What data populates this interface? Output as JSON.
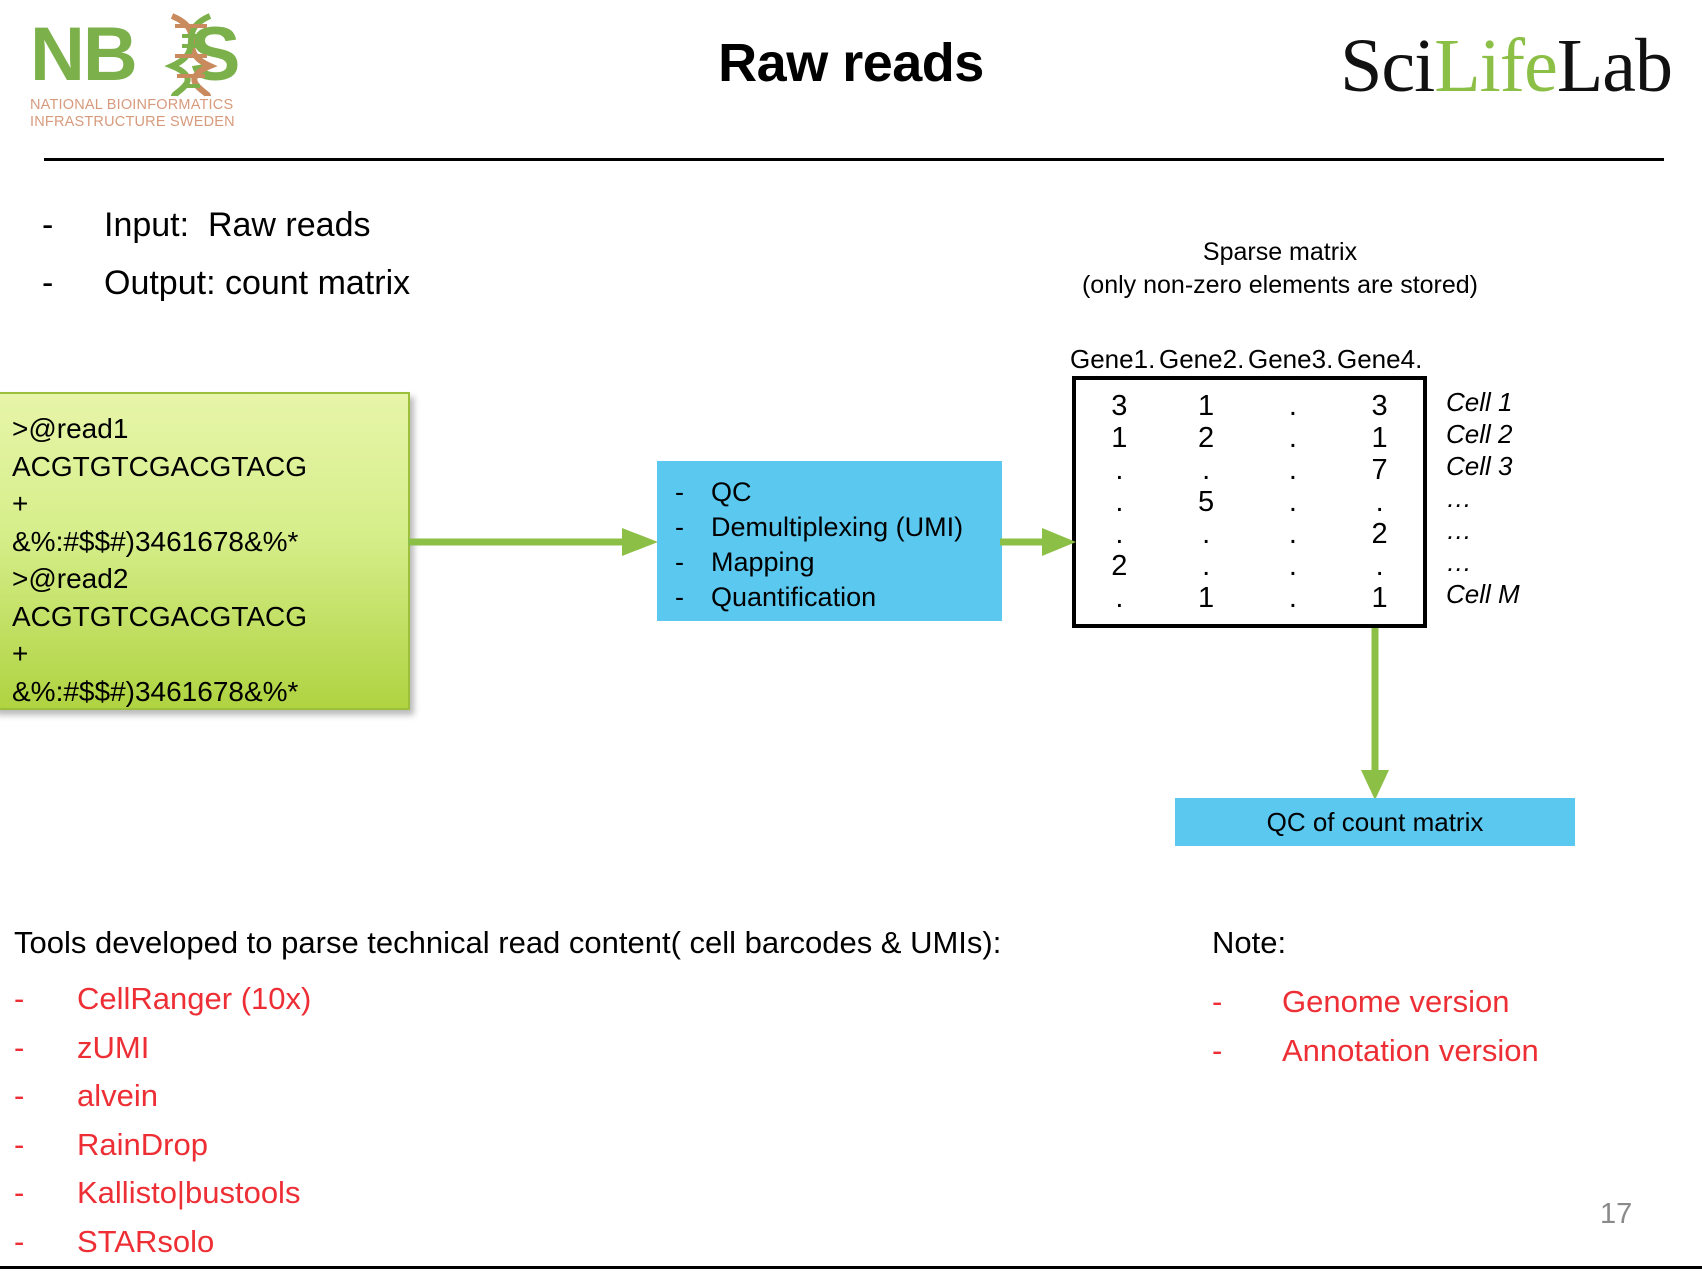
{
  "header": {
    "title": "Raw reads",
    "nbis_logo": {
      "wordmark_left": "NB",
      "wordmark_right": "S",
      "subtitle_line1": "NATIONAL BIOINFORMATICS",
      "subtitle_line2": "INFRASTRUCTURE SWEDEN",
      "green": "#7BB04A",
      "subtitle_color": "#D79A7C"
    },
    "scilifelab_logo": {
      "part1": "Sci",
      "part2": "Life",
      "part3": "Lab",
      "green": "#8CBF45"
    }
  },
  "io": {
    "dash": "-",
    "rows": [
      {
        "label": "Input:  Raw reads"
      },
      {
        "label": "Output: count matrix"
      }
    ]
  },
  "fastq": {
    "lines": ">@read1\nACGTGTCGACGTACG\n+\n&%:#$$#)3461678&%*\n>@read2\nACGTGTCGACGTACG\n+\n&%:#$$#)3461678&%*",
    "box_color_top": "#E6F5A9",
    "box_color_bottom": "#AFD341"
  },
  "process": {
    "dash": "-",
    "box_color": "#5BC8F0",
    "steps": [
      {
        "label": "QC"
      },
      {
        "label": "Demultiplexing (UMI)"
      },
      {
        "label": "Mapping"
      },
      {
        "label": "Quantification"
      }
    ]
  },
  "sparse": {
    "caption_line1": "Sparse matrix",
    "caption_line2": "(only non-zero elements are stored)",
    "gene_headers": [
      "Gene1.",
      "Gene2.",
      "Gene3.",
      "Gene4."
    ],
    "rows": [
      {
        "values": [
          "3",
          "1",
          ".",
          "3"
        ],
        "cell": "Cell 1"
      },
      {
        "values": [
          "1",
          "2",
          ".",
          "1"
        ],
        "cell": "Cell 2"
      },
      {
        "values": [
          ".",
          ".",
          ".",
          "7"
        ],
        "cell": "Cell 3"
      },
      {
        "values": [
          ".",
          "5",
          ".",
          "."
        ],
        "cell": "…"
      },
      {
        "values": [
          ".",
          ".",
          ".",
          "2"
        ],
        "cell": "…"
      },
      {
        "values": [
          "2",
          ".",
          ".",
          "."
        ],
        "cell": "…"
      },
      {
        "values": [
          ".",
          "1",
          ".",
          "1"
        ],
        "cell": "Cell M"
      }
    ]
  },
  "qc_matrix": {
    "label": "QC of count matrix",
    "box_color": "#5BC8F0"
  },
  "tools": {
    "heading": "Tools developed to parse technical read content( cell barcodes & UMIs):",
    "dash": "-",
    "accent": "#ED2F35",
    "items": [
      {
        "label": "CellRanger (10x)"
      },
      {
        "label": "zUMI"
      },
      {
        "label": "alvein"
      },
      {
        "label": "RainDrop"
      },
      {
        "label": "Kallisto|bustools"
      },
      {
        "label": "STARsolo"
      }
    ]
  },
  "note": {
    "heading": "Note:",
    "dash": "-",
    "items": [
      {
        "label": "Genome version"
      },
      {
        "label": "Annotation version"
      }
    ]
  },
  "footer": {
    "page_number": "17"
  },
  "arrow_color": "#8CBF45"
}
